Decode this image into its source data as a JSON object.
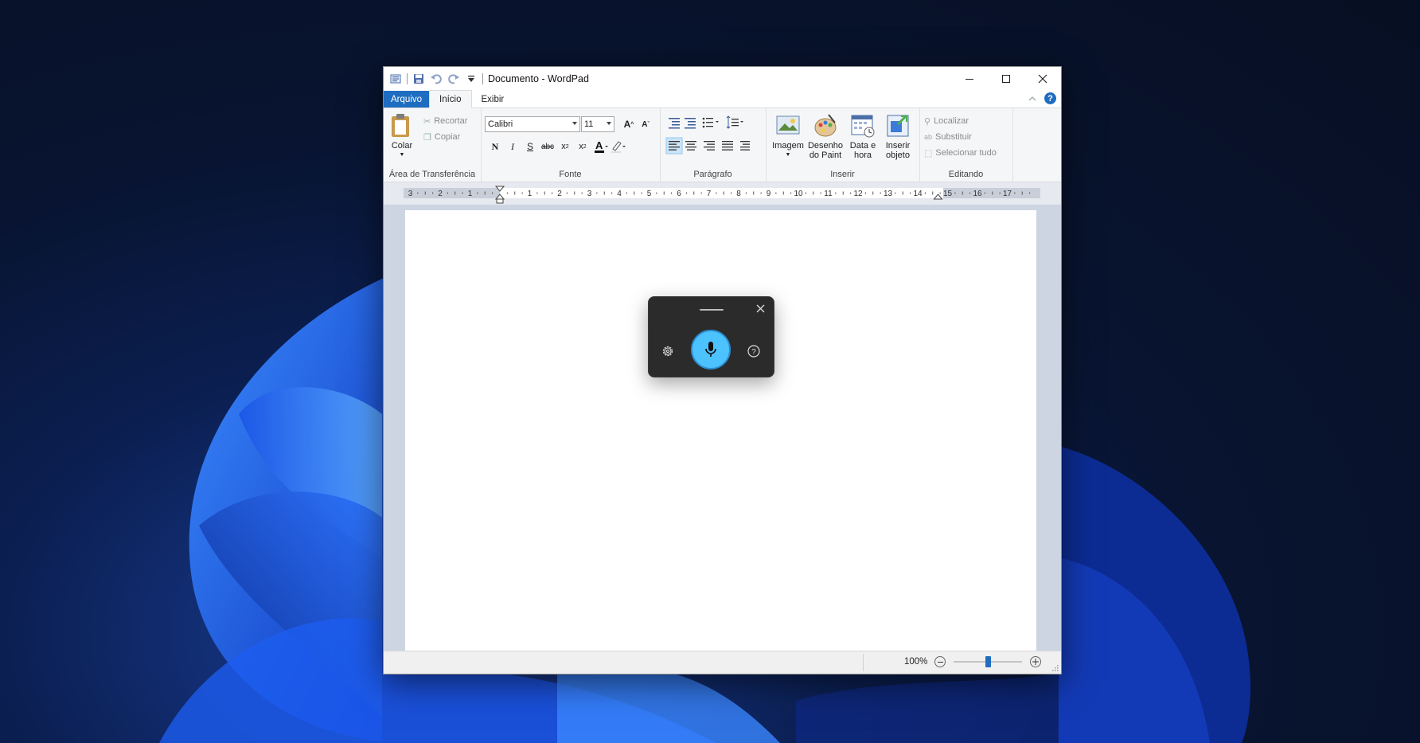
{
  "window": {
    "title": "Documento - WordPad",
    "controls": {
      "minimize": "minimize-icon",
      "maximize": "maximize-icon",
      "close": "close-icon"
    }
  },
  "quick_access": [
    "wordpad-app-icon",
    "save-icon",
    "undo-icon",
    "redo-icon",
    "customize-dropdown-icon"
  ],
  "tabs": [
    {
      "label": "Arquivo"
    },
    {
      "label": "Início"
    },
    {
      "label": "Exibir"
    }
  ],
  "ribbon": {
    "clipboard": {
      "label": "Área de Transferência",
      "paste": "Colar",
      "cut": "Recortar",
      "copy": "Copiar"
    },
    "font": {
      "label": "Fonte",
      "family": "Calibri",
      "size": "11",
      "bold": "N",
      "italic": "I",
      "strike": "abc"
    },
    "paragraph": {
      "label": "Parágrafo"
    },
    "insert": {
      "label": "Inserir",
      "image": "Imagem",
      "paint_line1": "Desenho",
      "paint_line2": "do Paint",
      "datetime_line1": "Data e",
      "datetime_line2": "hora",
      "object_line1": "Inserir",
      "object_line2": "objeto"
    },
    "editing": {
      "label": "Editando",
      "find": "Localizar",
      "replace": "Substituir",
      "select_all": "Selecionar tudo"
    }
  },
  "ruler": {
    "numbers": [
      "3",
      "2",
      "1",
      "1",
      "2",
      "3",
      "4",
      "5",
      "6",
      "7",
      "8",
      "9",
      "10",
      "11",
      "12",
      "13",
      "14",
      "15",
      "16",
      "17"
    ]
  },
  "status": {
    "zoom": "100%"
  },
  "voice_typing": {
    "settings_icon": "gear-icon",
    "mic_icon": "microphone-icon",
    "help_icon": "help-icon",
    "accent": "#4cc2ff"
  },
  "colors": {
    "file_tab": "#1e6dc1",
    "help_badge": "#1e6dc1"
  }
}
